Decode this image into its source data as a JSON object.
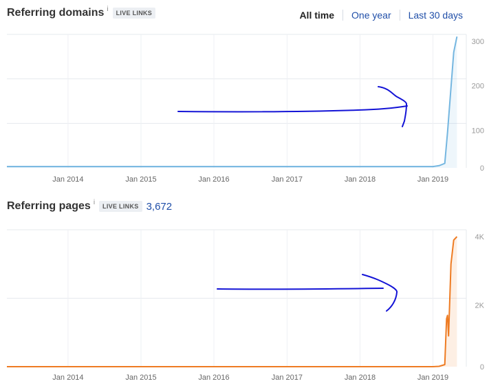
{
  "header": {
    "range_options": [
      "All time",
      "One year",
      "Last 30 days"
    ],
    "active_range": "All time"
  },
  "chart_data": [
    {
      "type": "line",
      "title": "Referring domains",
      "info_mark": "i",
      "badge": "LIVE LINKS",
      "color": "#74b6e0",
      "x_ticks": [
        "Jan 2014",
        "Jan 2015",
        "Jan 2016",
        "Jan 2017",
        "Jan 2018",
        "Jan 2019"
      ],
      "y_ticks": [
        "0",
        "100",
        "200",
        "300"
      ],
      "ylim": [
        0,
        300
      ],
      "series": [
        {
          "x": [
            "2013-03",
            "2018-12",
            "2019-01",
            "2019-02",
            "2019-03",
            "2019-03-15",
            "2019-04",
            "2019-04-15",
            "2019-05"
          ],
          "values": [
            3,
            3,
            3,
            5,
            10,
            80,
            180,
            260,
            295
          ]
        }
      ]
    },
    {
      "type": "line",
      "title": "Referring pages",
      "info_mark": "i",
      "badge": "LIVE LINKS",
      "count": "3,672",
      "color": "#ee7b22",
      "x_ticks": [
        "Jan 2014",
        "Jan 2015",
        "Jan 2016",
        "Jan 2017",
        "Jan 2018",
        "Jan 2019"
      ],
      "y_ticks": [
        "0",
        "2K",
        "4K"
      ],
      "ylim": [
        0,
        4000
      ],
      "series": [
        {
          "x": [
            "2013-03",
            "2018-12",
            "2019-01",
            "2019-02",
            "2019-03",
            "2019-03-10",
            "2019-03-15",
            "2019-03-20",
            "2019-04",
            "2019-04-15",
            "2019-05"
          ],
          "values": [
            0,
            0,
            0,
            10,
            60,
            1400,
            1500,
            900,
            3000,
            3700,
            3800
          ]
        }
      ]
    }
  ]
}
